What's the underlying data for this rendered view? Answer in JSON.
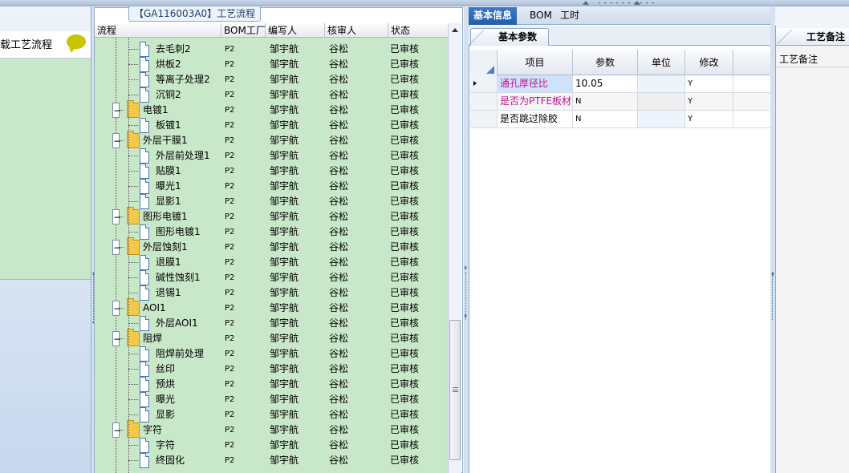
{
  "left_panel": {
    "item_label": "载工艺流程"
  },
  "flow_panel": {
    "title": "【GA116003A0】工艺流程",
    "columns": [
      "流程",
      "BOM工厂",
      "编写人",
      "核审人",
      "状态"
    ],
    "rows": [
      {
        "name": "去毛刺2",
        "level": 2,
        "bom": "P2",
        "writer": "邹宇航",
        "reviewer": "谷松",
        "status": "已审核"
      },
      {
        "name": "烘板2",
        "level": 2,
        "bom": "P2",
        "writer": "邹宇航",
        "reviewer": "谷松",
        "status": "已审核"
      },
      {
        "name": "等离子处理2",
        "level": 2,
        "bom": "P2",
        "writer": "邹宇航",
        "reviewer": "谷松",
        "status": "已审核"
      },
      {
        "name": "沉铜2",
        "level": 2,
        "bom": "P2",
        "writer": "邹宇航",
        "reviewer": "谷松",
        "status": "已审核"
      },
      {
        "name": "电镀1",
        "level": 1,
        "bom": "P2",
        "writer": "邹宇航",
        "reviewer": "谷松",
        "status": "已审核"
      },
      {
        "name": "板镀1",
        "level": 2,
        "bom": "P2",
        "writer": "邹宇航",
        "reviewer": "谷松",
        "status": "已审核"
      },
      {
        "name": "外层干膜1",
        "level": 1,
        "bom": "P2",
        "writer": "邹宇航",
        "reviewer": "谷松",
        "status": "已审核"
      },
      {
        "name": "外层前处理1",
        "level": 2,
        "bom": "P2",
        "writer": "邹宇航",
        "reviewer": "谷松",
        "status": "已审核"
      },
      {
        "name": "贴膜1",
        "level": 2,
        "bom": "P2",
        "writer": "邹宇航",
        "reviewer": "谷松",
        "status": "已审核"
      },
      {
        "name": "曝光1",
        "level": 2,
        "bom": "P2",
        "writer": "邹宇航",
        "reviewer": "谷松",
        "status": "已审核"
      },
      {
        "name": "显影1",
        "level": 2,
        "bom": "P2",
        "writer": "邹宇航",
        "reviewer": "谷松",
        "status": "已审核"
      },
      {
        "name": "图形电镀1",
        "level": 1,
        "bom": "P2",
        "writer": "邹宇航",
        "reviewer": "谷松",
        "status": "已审核"
      },
      {
        "name": "图形电镀1",
        "level": 2,
        "bom": "P2",
        "writer": "邹宇航",
        "reviewer": "谷松",
        "status": "已审核"
      },
      {
        "name": "外层蚀刻1",
        "level": 1,
        "bom": "P2",
        "writer": "邹宇航",
        "reviewer": "谷松",
        "status": "已审核"
      },
      {
        "name": "退膜1",
        "level": 2,
        "bom": "P2",
        "writer": "邹宇航",
        "reviewer": "谷松",
        "status": "已审核"
      },
      {
        "name": "碱性蚀刻1",
        "level": 2,
        "bom": "P2",
        "writer": "邹宇航",
        "reviewer": "谷松",
        "status": "已审核"
      },
      {
        "name": "退锡1",
        "level": 2,
        "bom": "P2",
        "writer": "邹宇航",
        "reviewer": "谷松",
        "status": "已审核"
      },
      {
        "name": "AOI1",
        "level": 1,
        "bom": "P2",
        "writer": "邹宇航",
        "reviewer": "谷松",
        "status": "已审核"
      },
      {
        "name": "外层AOI1",
        "level": 2,
        "bom": "P2",
        "writer": "邹宇航",
        "reviewer": "谷松",
        "status": "已审核"
      },
      {
        "name": "阻焊",
        "level": 1,
        "bom": "P2",
        "writer": "邹宇航",
        "reviewer": "谷松",
        "status": "已审核"
      },
      {
        "name": "阻焊前处理",
        "level": 2,
        "bom": "P2",
        "writer": "邹宇航",
        "reviewer": "谷松",
        "status": "已审核"
      },
      {
        "name": "丝印",
        "level": 2,
        "bom": "P2",
        "writer": "邹宇航",
        "reviewer": "谷松",
        "status": "已审核"
      },
      {
        "name": "预烘",
        "level": 2,
        "bom": "P2",
        "writer": "邹宇航",
        "reviewer": "谷松",
        "status": "已审核"
      },
      {
        "name": "曝光",
        "level": 2,
        "bom": "P2",
        "writer": "邹宇航",
        "reviewer": "谷松",
        "status": "已审核"
      },
      {
        "name": "显影",
        "level": 2,
        "bom": "P2",
        "writer": "邹宇航",
        "reviewer": "谷松",
        "status": "已审核"
      },
      {
        "name": "字符",
        "level": 1,
        "bom": "P2",
        "writer": "邹宇航",
        "reviewer": "谷松",
        "status": "已审核"
      },
      {
        "name": "字符",
        "level": 2,
        "bom": "P2",
        "writer": "邹宇航",
        "reviewer": "谷松",
        "status": "已审核"
      },
      {
        "name": "终固化",
        "level": 2,
        "bom": "P2",
        "writer": "邹宇航",
        "reviewer": "谷松",
        "status": "已审核"
      }
    ]
  },
  "info_panel": {
    "tabs": [
      "基本信息",
      "BOM",
      "工时"
    ],
    "active_tab": "基本信息",
    "subtab": "基本参数",
    "columns": [
      "项目",
      "参数",
      "单位",
      "修改"
    ],
    "rows": [
      {
        "item": "通孔厚径比",
        "param": "10.05",
        "unit": "",
        "modify": "Y"
      },
      {
        "item": "是否为PTFE板材",
        "param": "N",
        "unit": "",
        "modify": "Y"
      },
      {
        "item": "是否跳过除胶",
        "param": "N",
        "unit": "",
        "modify": "Y"
      }
    ]
  },
  "remarks_panel": {
    "tab": "工艺备注",
    "label": "工艺备注"
  },
  "colors": {
    "tree_background": "#c9e8c9",
    "active_tab": "#2d67b3",
    "highlight_cell": "#cfe2fb",
    "pink_text": "#c0148c"
  }
}
